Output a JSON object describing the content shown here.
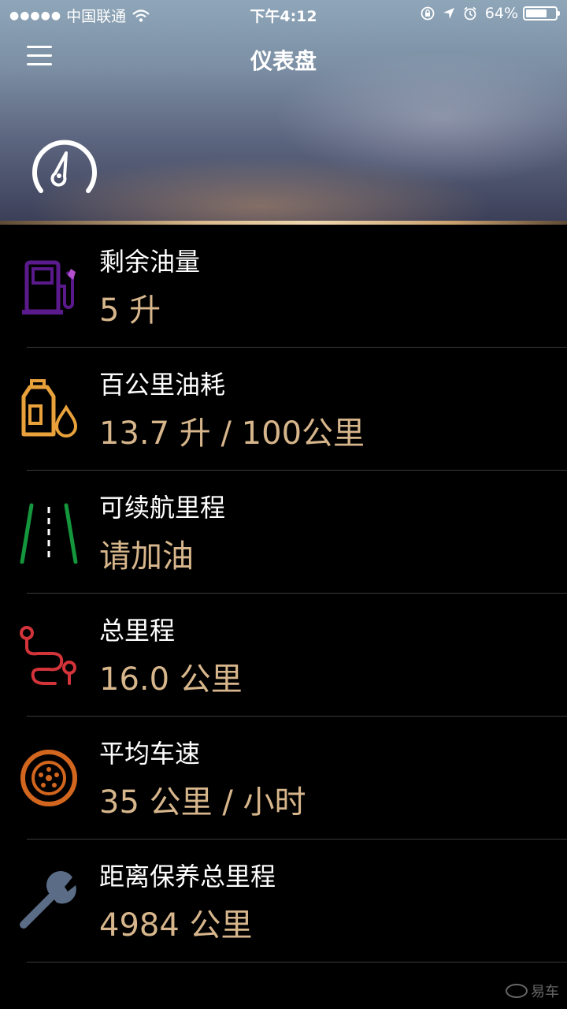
{
  "status_bar": {
    "signal_dots": "●●●●●",
    "carrier": "中国联通",
    "wifi_icon": "wifi-icon",
    "time": "下午4:12",
    "battery_percent": "64%",
    "battery_level": 0.64
  },
  "nav": {
    "title": "仪表盘",
    "menu_icon": "hamburger-menu-icon"
  },
  "header": {
    "gauge_icon": "speedometer-icon"
  },
  "items": [
    {
      "label": "剩余油量",
      "value": "5 升",
      "icon": "fuel-pump-icon",
      "color": "#5b1a8c"
    },
    {
      "label": "百公里油耗",
      "value": "13.7 升 / 100公里",
      "icon": "oil-can-icon",
      "color": "#e9a23b"
    },
    {
      "label": "可续航里程",
      "value": "请加油",
      "icon": "road-icon",
      "color": "#14963c"
    },
    {
      "label": "总里程",
      "value": "16.0 公里",
      "icon": "route-icon",
      "color": "#d2343a"
    },
    {
      "label": "平均车速",
      "value": "35 公里 / 小时",
      "icon": "wheel-icon",
      "color": "#d2661e"
    },
    {
      "label": "距离保养总里程",
      "value": "4984 公里",
      "icon": "wrench-icon",
      "color": "#5a6c86"
    }
  ],
  "colors": {
    "value_text": "#d7b68c",
    "divider": "#3a3a3a"
  },
  "watermark": "易车"
}
